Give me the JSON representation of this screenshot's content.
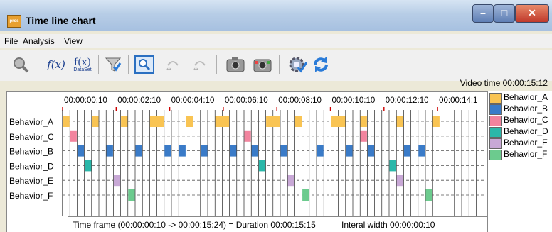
{
  "window": {
    "title": "Time line chart",
    "app_icon_text": "pros"
  },
  "menu": [
    {
      "label": "File"
    },
    {
      "label": "Analysis"
    },
    {
      "label": "View"
    }
  ],
  "toolbar": {
    "items": [
      {
        "icon": "magnifier-icon"
      },
      {
        "icon": "function-icon",
        "text": "f(x)"
      },
      {
        "icon": "function-dataset-icon",
        "text": "f(x)",
        "sub": "DataSet"
      },
      {
        "icon": "filter-icon"
      },
      {
        "icon": "zoom-window-icon"
      },
      {
        "icon": "fit-width-icon"
      },
      {
        "icon": "fit-width-alt-icon"
      },
      {
        "icon": "camera-icon"
      },
      {
        "icon": "camera-color-icon"
      },
      {
        "icon": "settings-gear-icon"
      },
      {
        "icon": "refresh-icon"
      }
    ]
  },
  "video_time": "Video time 00:00:15:12",
  "timeline": {
    "tick_labels": [
      "00:00:00:10",
      "00:00:02:10",
      "00:00:04:10",
      "00:00:06:10",
      "00:00:08:10",
      "00:00:10:10",
      "00:00:12:10",
      "00:00:14:1"
    ],
    "rows": [
      {
        "label": "Behavior_A",
        "color": "#f9c453",
        "segments": [
          [
            0,
            1
          ],
          [
            4,
            5
          ],
          [
            8,
            9
          ],
          [
            12,
            14
          ],
          [
            17,
            18
          ],
          [
            21,
            23
          ],
          [
            28,
            30
          ],
          [
            32,
            33
          ],
          [
            37,
            39
          ],
          [
            41,
            42
          ],
          [
            46,
            47
          ],
          [
            51,
            52
          ]
        ]
      },
      {
        "label": "Behavior_C",
        "color": "#f2849e",
        "segments": [
          [
            1,
            2
          ],
          [
            25,
            26
          ],
          [
            41,
            42
          ]
        ]
      },
      {
        "label": "Behavior_B",
        "color": "#3a7bc8",
        "segments": [
          [
            2,
            3
          ],
          [
            6,
            7
          ],
          [
            10,
            11
          ],
          [
            14,
            15
          ],
          [
            16,
            17
          ],
          [
            19,
            20
          ],
          [
            23,
            24
          ],
          [
            26,
            27
          ],
          [
            30,
            31
          ],
          [
            35,
            36
          ],
          [
            39,
            40
          ],
          [
            42,
            43
          ],
          [
            47,
            48
          ],
          [
            49,
            50
          ]
        ]
      },
      {
        "label": "Behavior_D",
        "color": "#2ab7a9",
        "segments": [
          [
            3,
            4
          ],
          [
            27,
            28
          ],
          [
            45,
            46
          ]
        ]
      },
      {
        "label": "Behavior_E",
        "color": "#c8a8d6",
        "segments": [
          [
            7,
            8
          ],
          [
            31,
            32
          ],
          [
            46,
            47
          ]
        ]
      },
      {
        "label": "Behavior_F",
        "color": "#6ccb8e",
        "segments": [
          [
            9,
            10
          ],
          [
            33,
            34
          ],
          [
            50,
            51
          ]
        ]
      }
    ],
    "footer_timeframe": "Time frame (00:00:00:10 -> 00:00:15:24) = Duration 00:00:15:15",
    "footer_interval": "Interal width 00:00:00:10"
  },
  "legend": [
    {
      "label": "Behavior_A",
      "color": "#f9c453"
    },
    {
      "label": "Behavior_B",
      "color": "#3a7bc8"
    },
    {
      "label": "Behavior_C",
      "color": "#f2849e"
    },
    {
      "label": "Behavior_D",
      "color": "#2ab7a9"
    },
    {
      "label": "Behavior_E",
      "color": "#c8a8d6"
    },
    {
      "label": "Behavior_F",
      "color": "#6ccb8e"
    }
  ]
}
